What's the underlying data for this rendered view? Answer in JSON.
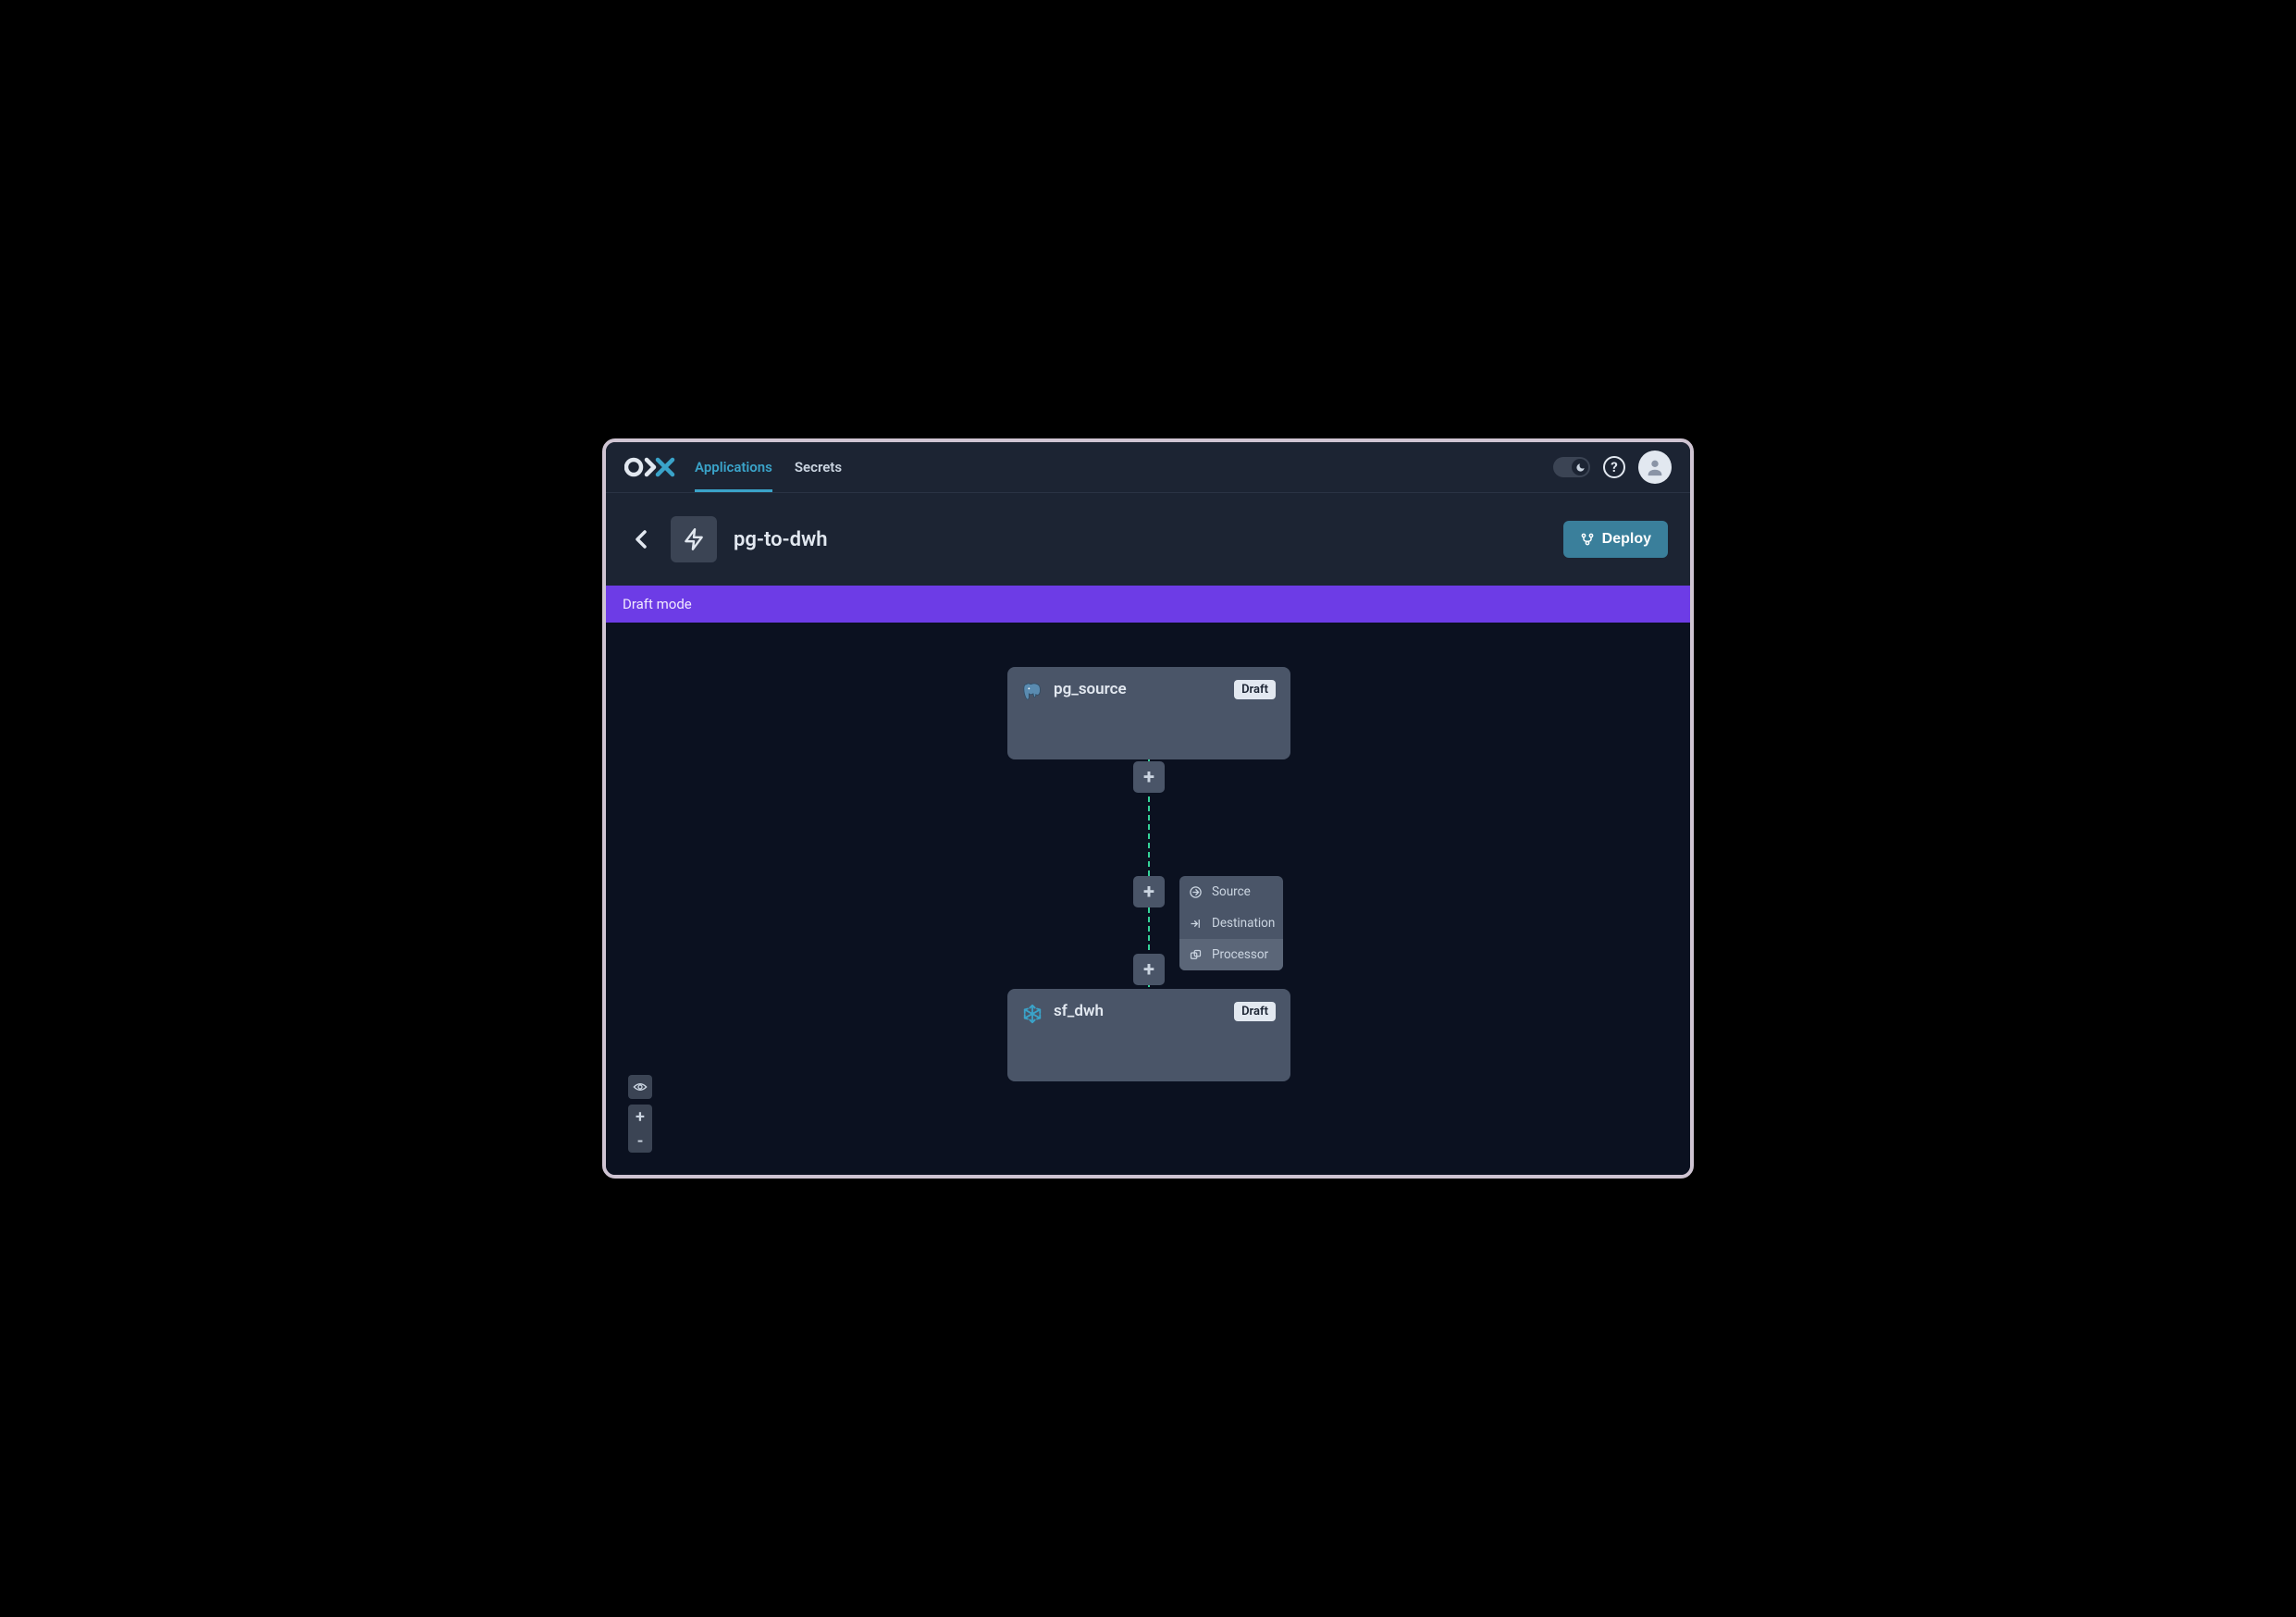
{
  "nav": {
    "tabs": [
      {
        "label": "Applications",
        "active": true
      },
      {
        "label": "Secrets",
        "active": false
      }
    ]
  },
  "header": {
    "app_name": "pg-to-dwh",
    "deploy_label": "Deploy"
  },
  "banner": {
    "text": "Draft mode"
  },
  "canvas": {
    "nodes": [
      {
        "name": "pg_source",
        "badge": "Draft",
        "icon": "postgres"
      },
      {
        "name": "sf_dwh",
        "badge": "Draft",
        "icon": "snowflake"
      }
    ],
    "popup": {
      "items": [
        {
          "label": "Source",
          "icon": "source"
        },
        {
          "label": "Destination",
          "icon": "destination"
        },
        {
          "label": "Processor",
          "icon": "processor",
          "highlight": true
        }
      ]
    }
  }
}
